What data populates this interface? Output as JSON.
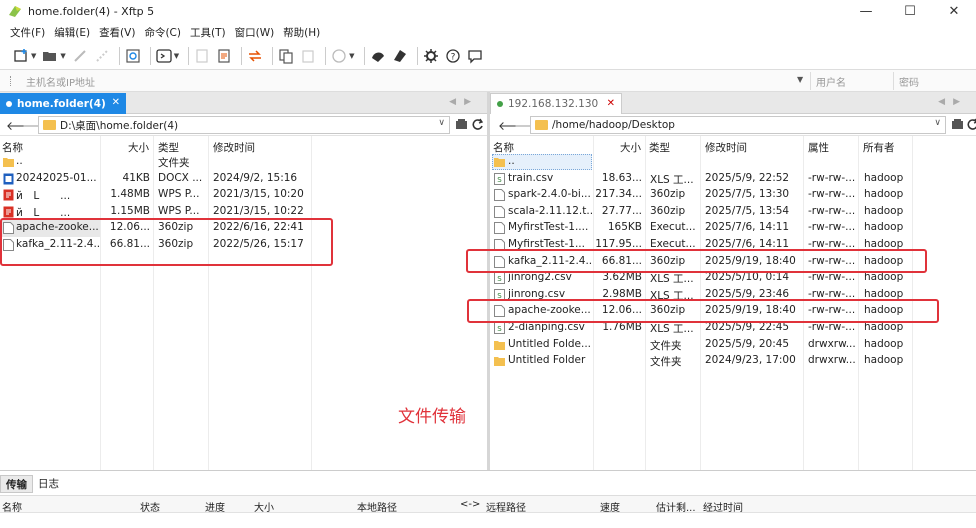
{
  "window": {
    "title": "home.folder(4) - Xftp 5",
    "minimize": "—",
    "maximize": "☐",
    "close": "✕"
  },
  "menu": [
    "文件(F)",
    "编辑(E)",
    "查看(V)",
    "命令(C)",
    "工具(T)",
    "窗口(W)",
    "帮助(H)"
  ],
  "address_bar": {
    "host_placeholder": "主机名或IP地址",
    "user_placeholder": "用户名",
    "password_placeholder": "密码"
  },
  "left_pane": {
    "tab_label": "home.folder(4)",
    "path": "D:\\桌面\\home.folder(4)",
    "columns": [
      "名称",
      "大小",
      "类型",
      "修改时间"
    ],
    "rows": [
      {
        "name": "..",
        "size": "",
        "type": "文件夹",
        "modified": "",
        "icon": "folder-up"
      },
      {
        "name": "20242025-01...",
        "size": "41KB",
        "type": "DOCX ...",
        "modified": "2024/9/2, 15:16",
        "icon": "docx"
      },
      {
        "name": "й　L　　...",
        "size": "1.48MB",
        "type": "WPS P...",
        "modified": "2021/3/15, 10:20",
        "icon": "wps"
      },
      {
        "name": "й　L　　...",
        "size": "1.15MB",
        "type": "WPS P...",
        "modified": "2021/3/15, 10:22",
        "icon": "wps"
      },
      {
        "name": "apache-zooke...",
        "size": "12.06...",
        "type": "360zip",
        "modified": "2022/6/16, 22:41",
        "icon": "file"
      },
      {
        "name": "kafka_2.11-2.4....",
        "size": "66.81...",
        "type": "360zip",
        "modified": "2022/5/26, 15:17",
        "icon": "file"
      }
    ]
  },
  "right_pane": {
    "tab_label": "192.168.132.130",
    "path": "/home/hadoop/Desktop",
    "columns": [
      "名称",
      "大小",
      "类型",
      "修改时间",
      "属性",
      "所有者"
    ],
    "rows": [
      {
        "name": "..",
        "size": "",
        "type": "",
        "modified": "",
        "attr": "",
        "owner": "",
        "icon": "folder-up"
      },
      {
        "name": "train.csv",
        "size": "18.63...",
        "type": "XLS 工...",
        "modified": "2025/5/9, 22:52",
        "attr": "-rw-rw-...",
        "owner": "hadoop",
        "icon": "xls"
      },
      {
        "name": "spark-2.4.0-bi...",
        "size": "217.34...",
        "type": "360zip",
        "modified": "2025/7/5, 13:30",
        "attr": "-rw-rw-...",
        "owner": "hadoop",
        "icon": "file"
      },
      {
        "name": "scala-2.11.12.t...",
        "size": "27.77...",
        "type": "360zip",
        "modified": "2025/7/5, 13:54",
        "attr": "-rw-rw-...",
        "owner": "hadoop",
        "icon": "file"
      },
      {
        "name": "MyfirstTest-1....",
        "size": "165KB",
        "type": "Execut...",
        "modified": "2025/7/6, 14:11",
        "attr": "-rw-rw-...",
        "owner": "hadoop",
        "icon": "file"
      },
      {
        "name": "MyfirstTest-1...",
        "size": "117.95...",
        "type": "Execut...",
        "modified": "2025/7/6, 14:11",
        "attr": "-rw-rw-...",
        "owner": "hadoop",
        "icon": "file"
      },
      {
        "name": "kafka_2.11-2.4....",
        "size": "66.81...",
        "type": "360zip",
        "modified": "2025/9/19, 18:40",
        "attr": "-rw-rw-...",
        "owner": "hadoop",
        "icon": "file"
      },
      {
        "name": "jinrong2.csv",
        "size": "3.62MB",
        "type": "XLS 工...",
        "modified": "2025/5/10, 0:14",
        "attr": "-rw-rw-...",
        "owner": "hadoop",
        "icon": "xls"
      },
      {
        "name": "jinrong.csv",
        "size": "2.98MB",
        "type": "XLS 工...",
        "modified": "2025/5/9, 23:46",
        "attr": "-rw-rw-...",
        "owner": "hadoop",
        "icon": "xls"
      },
      {
        "name": "apache-zooke...",
        "size": "12.06...",
        "type": "360zip",
        "modified": "2025/9/19, 18:40",
        "attr": "-rw-rw-...",
        "owner": "hadoop",
        "icon": "file"
      },
      {
        "name": "2-dianping.csv",
        "size": "1.76MB",
        "type": "XLS 工...",
        "modified": "2025/5/9, 22:45",
        "attr": "-rw-rw-...",
        "owner": "hadoop",
        "icon": "xls"
      },
      {
        "name": "Untitled Folde...",
        "size": "",
        "type": "文件夹",
        "modified": "2025/5/9, 20:45",
        "attr": "drwxrw...",
        "owner": "hadoop",
        "icon": "folder"
      },
      {
        "name": "Untitled Folder",
        "size": "",
        "type": "文件夹",
        "modified": "2024/9/23, 17:00",
        "attr": "drwxrw...",
        "owner": "hadoop",
        "icon": "folder"
      }
    ]
  },
  "annotation": "文件传输",
  "bottom": {
    "tabs": [
      "传输",
      "日志"
    ],
    "columns": [
      "名称",
      "状态",
      "进度",
      "大小",
      "本地路径",
      "<->",
      "远程路径",
      "速度",
      "估计剩...",
      "经过时间"
    ]
  },
  "colors": {
    "accent": "#1e88e5",
    "highlight_box": "#e0323a",
    "folder": "#f4c04f"
  }
}
